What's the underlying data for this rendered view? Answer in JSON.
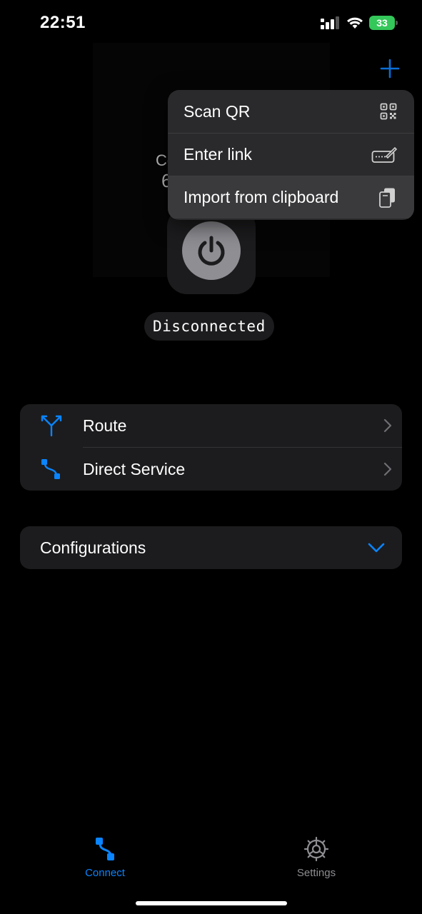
{
  "status_bar": {
    "time": "22:51",
    "battery": "33"
  },
  "main": {
    "status_label": "Disconnected"
  },
  "menu": {
    "items": [
      {
        "label": "Scan QR",
        "icon": "qr-code-icon"
      },
      {
        "label": "Enter link",
        "icon": "keyboard-link-icon"
      },
      {
        "label": "Import from clipboard",
        "icon": "clipboard-icon"
      }
    ]
  },
  "list": {
    "items": [
      {
        "label": "Route",
        "icon": "route-split-icon"
      },
      {
        "label": "Direct Service",
        "icon": "direct-path-icon"
      }
    ]
  },
  "configurations": {
    "label": "Configurations"
  },
  "tabs": [
    {
      "label": "Connect",
      "icon": "connect-path-icon",
      "active": true
    },
    {
      "label": "Settings",
      "icon": "gear-icon",
      "active": false
    }
  ],
  "colors": {
    "accent": "#0a84ff",
    "battery": "#34c759",
    "card": "#1c1c1e",
    "menu": "#2a2a2c"
  }
}
